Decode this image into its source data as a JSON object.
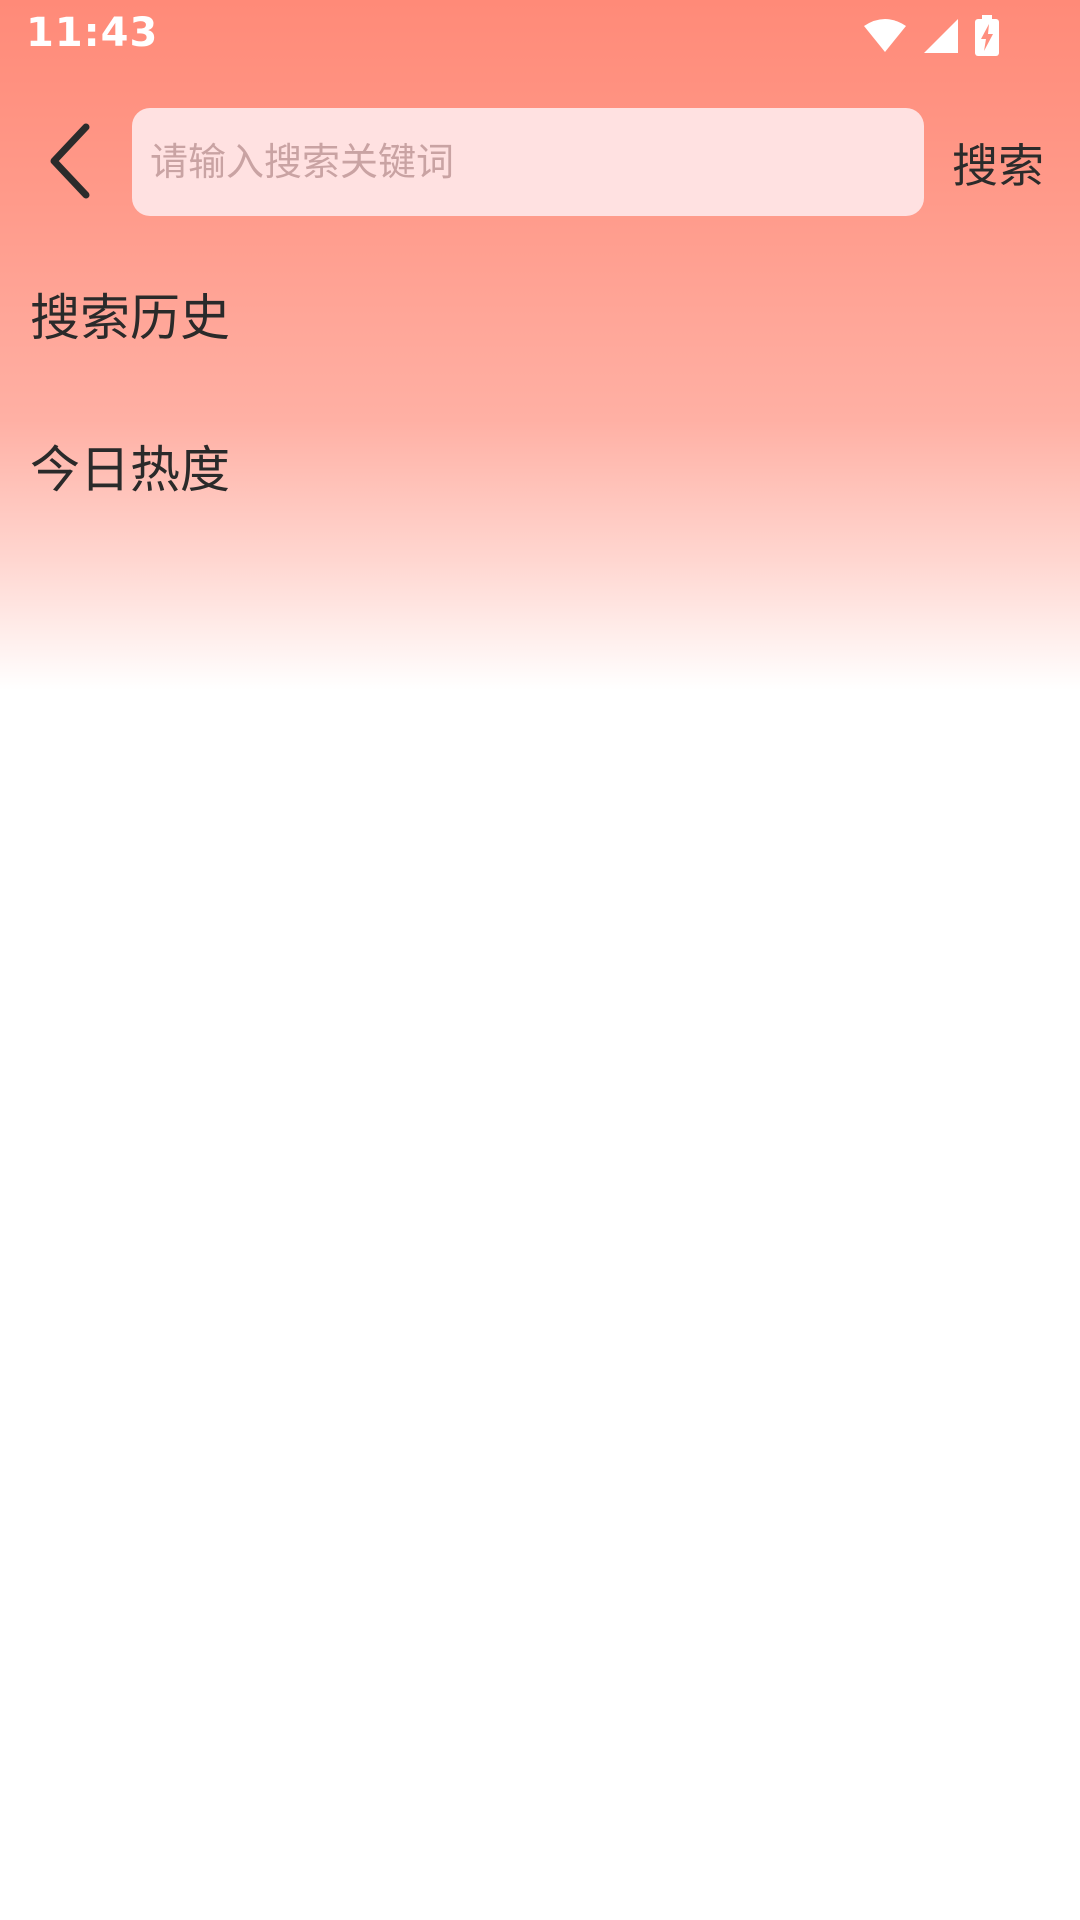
{
  "status_bar": {
    "time": "11:43",
    "icons": [
      "wifi-icon",
      "cellular-signal-icon",
      "battery-charging-icon"
    ]
  },
  "header": {
    "back_icon": "chevron-left-icon",
    "search_placeholder": "请输入搜索关键词",
    "search_value": "",
    "search_button_label": "搜索"
  },
  "sections": {
    "history_title": "搜索历史",
    "hot_title": "今日热度"
  },
  "colors": {
    "gradient_top": "#ff8a78",
    "search_box_bg": "#ffe1e1",
    "text_primary": "#2a2a2a",
    "placeholder": "#c9a3a3"
  }
}
